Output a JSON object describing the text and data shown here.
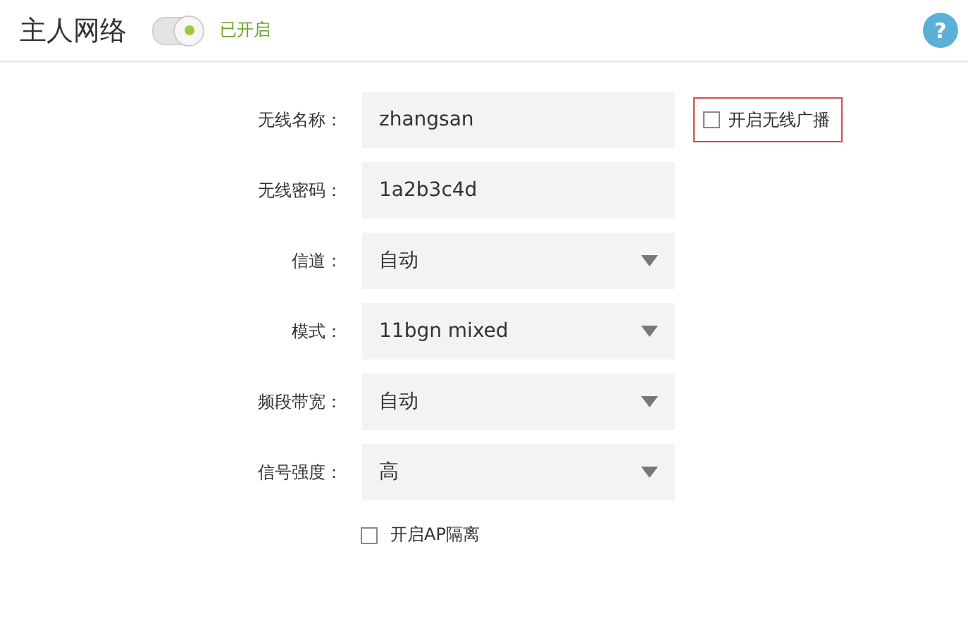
{
  "header": {
    "title": "主人网络",
    "switch_on": true,
    "status": "已开启",
    "help": "?"
  },
  "fields": [
    {
      "kind": "text",
      "label": "无线名称：",
      "value": "zhangsan",
      "extra": {
        "label": "开启无线广播",
        "checked": false
      }
    },
    {
      "kind": "text",
      "label": "无线密码：",
      "value": "1a2b3c4d"
    },
    {
      "kind": "select",
      "label": "信道：",
      "value": "自动"
    },
    {
      "kind": "select",
      "label": "模式：",
      "value": "11bgn mixed"
    },
    {
      "kind": "select",
      "label": "频段带宽：",
      "value": "自动"
    },
    {
      "kind": "select",
      "label": "信号强度：",
      "value": "高"
    }
  ],
  "ap_isolation": {
    "label": "开启AP隔离",
    "checked": false
  }
}
